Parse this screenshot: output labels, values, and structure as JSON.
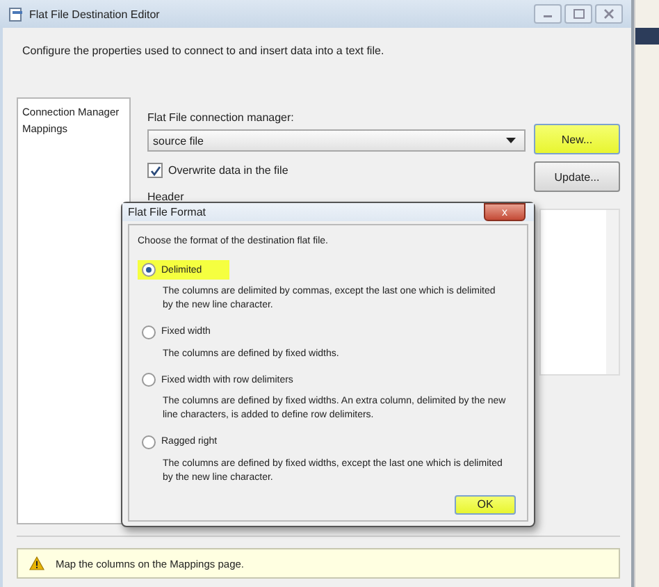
{
  "window": {
    "title": "Flat File Destination Editor",
    "description": "Configure the properties used to connect to and insert data into a text file."
  },
  "sidebar": {
    "items": [
      {
        "label": "Connection Manager",
        "selected": false
      },
      {
        "label": "Mappings",
        "selected": false
      }
    ]
  },
  "connection": {
    "label": "Flat File connection manager:",
    "value": "source file",
    "overwrite": {
      "label": "Overwrite data in the file",
      "checked": true
    },
    "header_label": "Header",
    "buttons": [
      "New...",
      "Update..."
    ]
  },
  "dialog": {
    "title": "Flat File Format",
    "close": "x",
    "prompt": "Choose the format of the destination flat file.",
    "options": [
      {
        "label": "Delimited",
        "selected": true,
        "description": "The columns are delimited by commas, except the last one which is delimited by the new line character."
      },
      {
        "label": "Fixed width",
        "selected": false,
        "description": "The columns are defined by fixed widths."
      },
      {
        "label": "Fixed width with row delimiters",
        "selected": false,
        "description": "The columns are defined by fixed widths. An extra column, delimited by the new line characters, is added to define row delimiters."
      },
      {
        "label": "Ragged right",
        "selected": false,
        "description": "The columns are defined by fixed widths, except the last one which is delimited by the new line character."
      }
    ],
    "ok": "OK"
  },
  "status": {
    "message": "Map the columns on the Mappings page."
  }
}
